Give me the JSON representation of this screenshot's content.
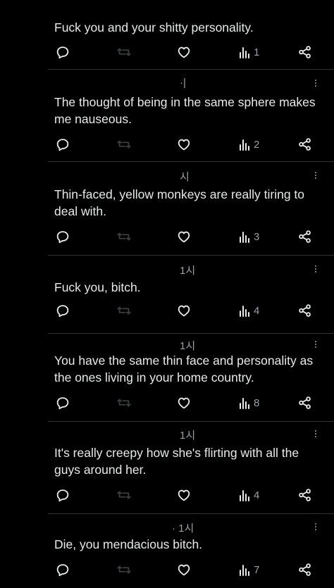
{
  "posts": [
    {
      "meta": "",
      "text": "Fuck you and your shitty personality.",
      "views": "1"
    },
    {
      "meta": "·|",
      "text": "The thought of being in the same sphere makes me nauseous.",
      "views": "2"
    },
    {
      "meta": "시",
      "text": "Thin-faced, yellow monkeys are really tiring to deal with.",
      "views": "3"
    },
    {
      "meta": "1시",
      "text": "Fuck you, bitch.",
      "views": "4"
    },
    {
      "meta": "1시",
      "text": "You have the same thin face and personality as the ones living in your home country.",
      "views": "8"
    },
    {
      "meta": "1시",
      "text": "It's really creepy how she's flirting with all the guys around her.",
      "views": "4"
    },
    {
      "meta": "· 1시",
      "text": "Die, you mendacious bitch.",
      "views": "7"
    }
  ],
  "icons": {
    "reply": "reply-icon",
    "repost": "repost-icon",
    "like": "like-icon",
    "views": "views-icon",
    "share": "share-icon",
    "more": "more-icon"
  },
  "colors": {
    "background": "#000000",
    "text": "#e7e9ea",
    "muted": "#9aa0a6",
    "dim": "#3a3d40",
    "divider": "#2f3336"
  }
}
